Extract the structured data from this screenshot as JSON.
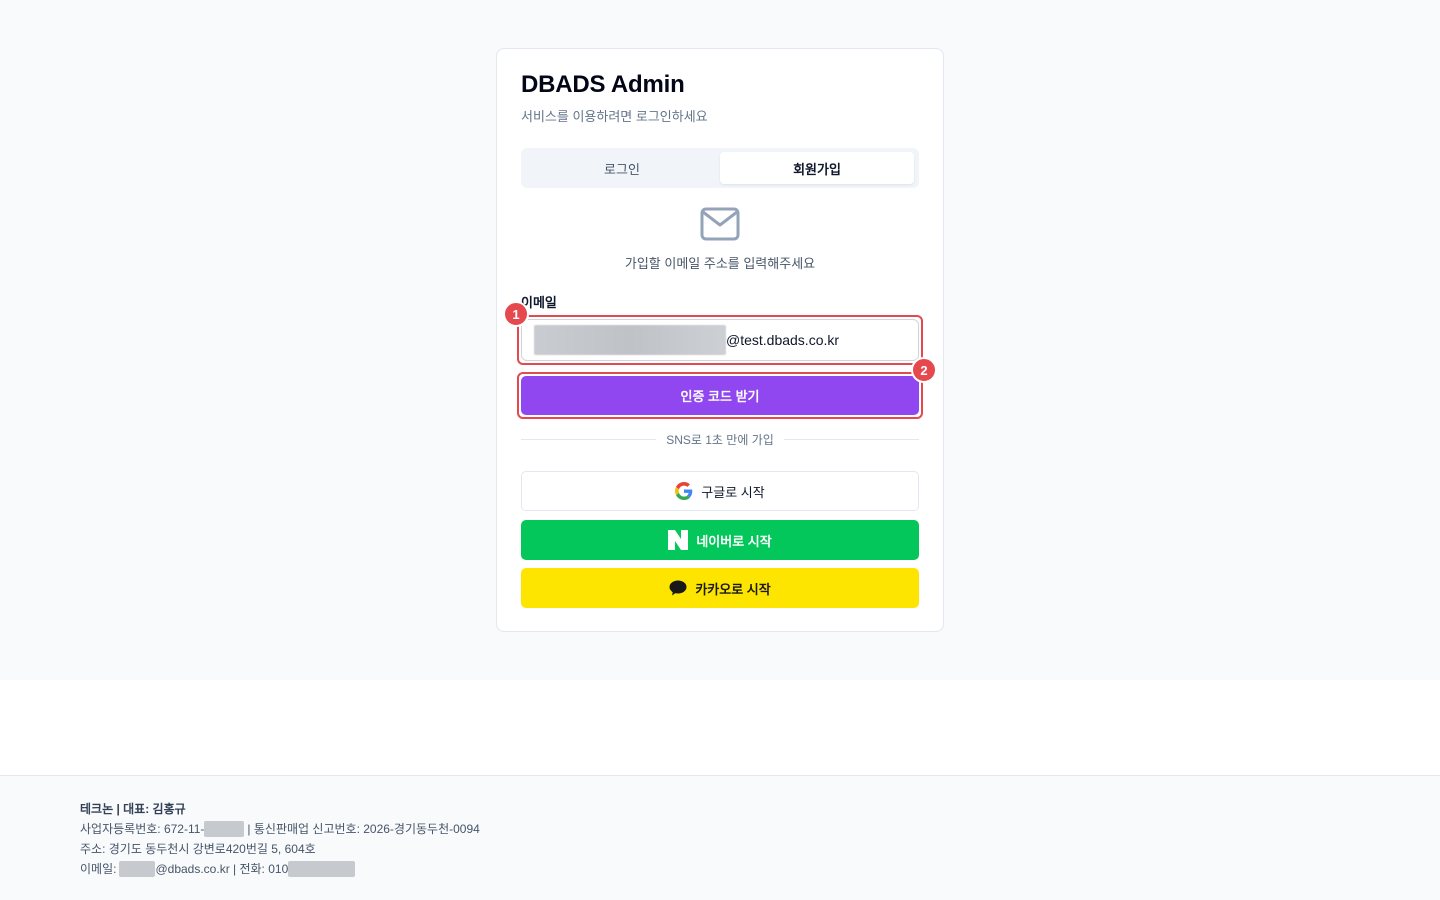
{
  "header": {
    "title": "DBADS Admin",
    "subtitle": "서비스를 이용하려면 로그인하세요"
  },
  "tabs": [
    {
      "label": "로그인",
      "active": false
    },
    {
      "label": "회원가입",
      "active": true
    }
  ],
  "signup": {
    "icon": "mail-icon",
    "info": "가입할 이메일 주소를 입력해주세요",
    "email_label": "이메일",
    "email_domain": "@test.dbads.co.kr",
    "code_button": "인증 코드 받기"
  },
  "annotations": {
    "badge_1": "1",
    "badge_2": "2",
    "color": "#e5484d"
  },
  "sns": {
    "divider": "SNS로 1초 만에 가입",
    "google": "구글로 시작",
    "naver": "네이버로 시작",
    "kakao": "카카오로 시작"
  },
  "colors": {
    "primary": "#9147f0",
    "naver": "#03c75a",
    "kakao": "#fee500"
  },
  "footer": {
    "company": "테크논 | 대표: 김홍규",
    "biz_prefix": "사업자등록번호: 672-11-",
    "biz_suffix": "| 통신판매업 신고번호: 2026-경기동두천-0094",
    "address": "주소: 경기도 동두천시 강변로420번길 5, 604호",
    "email_prefix": "이메일:",
    "email_suffix": "@dbads.co.kr | 전화: 010"
  }
}
